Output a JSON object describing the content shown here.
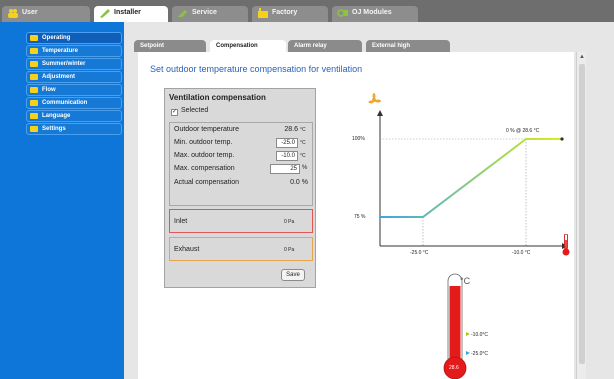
{
  "top_tabs": [
    {
      "label": "User",
      "active": false
    },
    {
      "label": "Installer",
      "active": true
    },
    {
      "label": "Service",
      "active": false
    },
    {
      "label": "Factory",
      "active": false
    },
    {
      "label": "OJ Modules",
      "active": false
    }
  ],
  "sidebar": {
    "items": [
      {
        "label": "Operating",
        "active": true
      },
      {
        "label": "Temperature"
      },
      {
        "label": "Summer/winter"
      },
      {
        "label": "Adjustment"
      },
      {
        "label": "Flow"
      },
      {
        "label": "Communication"
      },
      {
        "label": "Language"
      },
      {
        "label": "Settings"
      }
    ]
  },
  "inner_tabs": [
    {
      "label": "Setpoint",
      "active": false
    },
    {
      "label": "Compensation",
      "active": true
    },
    {
      "label": "Alarm relay",
      "active": false
    },
    {
      "label": "External high",
      "active": false
    }
  ],
  "content": {
    "title": "Set outdoor temperature compensation for ventilation"
  },
  "panel": {
    "title": "Ventilation compensation",
    "selected_label": "Selected",
    "selected_checked": true,
    "outdoor_temp_label": "Outdoor temperature",
    "outdoor_temp_value": "28.6",
    "outdoor_temp_unit": "°C",
    "min_outdoor_label": "Min. outdoor temp.",
    "min_outdoor_value": "-25.0",
    "min_outdoor_unit": "°C",
    "max_outdoor_label": "Max. outdoor temp.",
    "max_outdoor_value": "-10.0",
    "max_outdoor_unit": "°C",
    "max_comp_label": "Max. compensation",
    "max_comp_value": "25",
    "max_comp_unit": "%",
    "actual_comp_label": "Actual compensation",
    "actual_comp_value": "0.0 %",
    "inlet_label": "Inlet",
    "inlet_value": "0 Pa",
    "exhaust_label": "Exhaust",
    "exhaust_value": "0 Pa",
    "save_label": "Save"
  },
  "graph": {
    "y_top_label": "100%",
    "y_bottom_label": "75 %",
    "x_left_label": "-25.0 °C",
    "x_right_label": "-10.0 °C",
    "point_label": "0 % @ 28.6 °C"
  },
  "thermometer": {
    "unit": "°C",
    "marker_high": "-10.0°C",
    "marker_low": "-25.0°C",
    "bulb_value": "28.6"
  },
  "colors": {
    "sidebar_bg": "#0e76d8",
    "title_blue": "#2a62b8",
    "curve_start": "#3aa6e8",
    "curve_end": "#d9ee18",
    "inlet_border": "#e05555",
    "exhaust_border": "#e7a64b",
    "thermo_red": "#e31b1b"
  }
}
